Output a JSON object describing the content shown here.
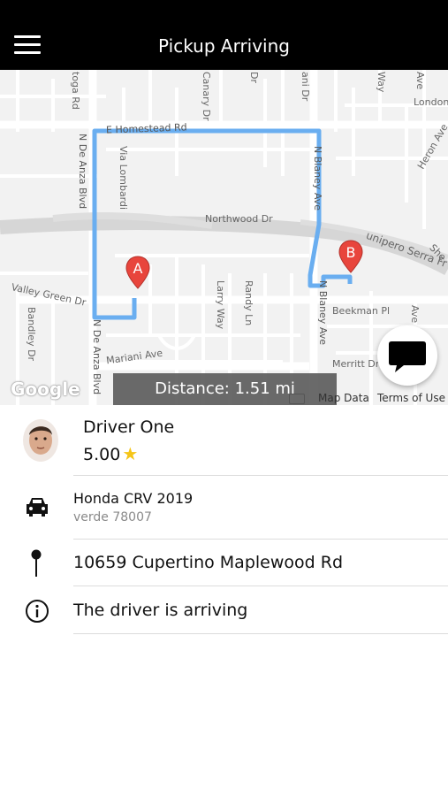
{
  "header": {
    "title": "Pickup Arriving",
    "menu_icon": "menu-icon"
  },
  "map": {
    "labels": {
      "saratoga_rd": "toga Rd",
      "canary_dr": "Canary Dr",
      "dr_top": "Dr",
      "ani_dr": "ani Dr",
      "way_top": "Way",
      "ave_top": "Ave",
      "london": "London",
      "e_homestead": "E Homestead Rd",
      "heron_ave": "Heron Ave",
      "via_lombardi": "Via Lombardi",
      "n_de_anza_upper": "N De Anza Blvd",
      "n_blaney_upper": "N Blaney Ave",
      "northwood": "Northwood Dr",
      "junipero": "unipero Serra Fr",
      "she": "She",
      "valley_green": "Valley Green Dr",
      "bandley": "Bandley Dr",
      "n_de_anza_lower": "N De Anza Blvd",
      "mariani": "Mariani Ave",
      "larry_way": "Larry Way",
      "randy_ln": "Randy Ln",
      "n_blaney_lower": "N Blaney Ave",
      "beekman": "Beekman Pl",
      "ave_right": "Ave",
      "merritt": "Merritt Dr"
    },
    "marker_a": "A",
    "marker_b": "B",
    "distance": "Distance: 1.51 mi",
    "google_logo": "Google",
    "map_data": "Map Data",
    "terms": "Terms of Use",
    "route_color": "#6aaef0",
    "marker_color": "#e8453c"
  },
  "chat_button": {
    "icon": "chat-bubble-icon"
  },
  "driver": {
    "name": "Driver One",
    "rating": "5.00",
    "star": "★"
  },
  "vehicle": {
    "model": "Honda CRV 2019",
    "plate": "verde 78007",
    "icon": "car-icon"
  },
  "pickup": {
    "address": "10659 Cupertino Maplewood Rd",
    "icon": "location-pin-icon"
  },
  "status": {
    "text": "The driver is arriving",
    "icon": "info-icon"
  }
}
